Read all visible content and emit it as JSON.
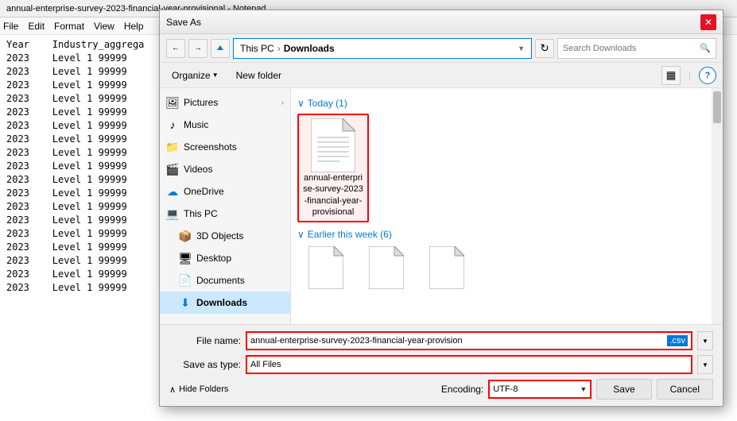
{
  "notepad": {
    "title": "annual-enterprise-survey-2023-financial-year-provisional - Notepad",
    "menu": {
      "file": "File",
      "edit": "Edit",
      "format": "Format",
      "view": "View",
      "help": "Help"
    },
    "rows": [
      {
        "col1": "Year",
        "col2": "Industry_aggrega"
      },
      {
        "col1": "2023",
        "col2": "Level 1 99999"
      },
      {
        "col1": "2023",
        "col2": "Level 1 99999"
      },
      {
        "col1": "2023",
        "col2": "Level 1 99999"
      },
      {
        "col1": "2023",
        "col2": "Level 1 99999"
      },
      {
        "col1": "2023",
        "col2": "Level 1 99999"
      },
      {
        "col1": "2023",
        "col2": "Level 1 99999"
      },
      {
        "col1": "2023",
        "col2": "Level 1 99999"
      },
      {
        "col1": "2023",
        "col2": "Level 1 99999"
      },
      {
        "col1": "2023",
        "col2": "Level 1 99999"
      },
      {
        "col1": "2023",
        "col2": "Level 1 99999"
      },
      {
        "col1": "2023",
        "col2": "Level 1 99999"
      },
      {
        "col1": "2023",
        "col2": "Level 1 99999"
      },
      {
        "col1": "2023",
        "col2": "Level 1 99999"
      },
      {
        "col1": "2023",
        "col2": "Level 1 99999"
      },
      {
        "col1": "2023",
        "col2": "Level 1 99999"
      },
      {
        "col1": "2023",
        "col2": "Level 1 99999"
      },
      {
        "col1": "2023",
        "col2": "Level 1 99999"
      },
      {
        "col1": "2023",
        "col2": "Level 1 99999"
      }
    ]
  },
  "dialog": {
    "title": "Save As",
    "close_label": "✕",
    "nav_back": "←",
    "nav_forward": "→",
    "nav_up": "↑",
    "address": {
      "this_pc": "This PC",
      "arrow": "›",
      "downloads": "Downloads",
      "dropdown_arrow": "▼"
    },
    "search_placeholder": "Search Downloads",
    "refresh_icon": "↻",
    "toolbar": {
      "organize": "Organize",
      "organize_arrow": "▼",
      "new_folder": "New folder",
      "view_icon": "▦",
      "help_label": "?"
    },
    "nav_items": [
      {
        "icon": "🖼",
        "label": "Pictures",
        "has_expand": true
      },
      {
        "icon": "♪",
        "label": "Music",
        "has_expand": false
      },
      {
        "icon": "📁",
        "label": "Screenshots",
        "has_expand": false
      },
      {
        "icon": "🎬",
        "label": "Videos",
        "has_expand": false
      },
      {
        "icon": "☁",
        "label": "OneDrive",
        "has_expand": false
      },
      {
        "icon": "💻",
        "label": "This PC",
        "has_expand": false
      },
      {
        "icon": "📦",
        "label": "3D Objects",
        "has_expand": false
      },
      {
        "icon": "🖥",
        "label": "Desktop",
        "has_expand": false
      },
      {
        "icon": "📄",
        "label": "Documents",
        "has_expand": false
      },
      {
        "icon": "⬇",
        "label": "Downloads",
        "has_expand": false,
        "active": true
      }
    ],
    "today_header": "Today (1)",
    "today_chevron": "∨",
    "file_today": {
      "name": "annual-enterprise-survey-2023-financial-year-provisional",
      "ext": ""
    },
    "earlier_header": "Earlier this week (6)",
    "earlier_chevron": "∨",
    "bottom": {
      "filename_label": "File name:",
      "filename_value": "annual-enterprise-survey-2023-financial-year-provision",
      "filename_ext": ".csv",
      "savetype_label": "Save as type:",
      "savetype_value": "All Files",
      "encoding_label": "Encoding:",
      "encoding_value": "UTF-8",
      "hide_folders": "Hide Folders",
      "hide_folders_arrow": "∧",
      "save_label": "Save",
      "cancel_label": "Cancel"
    }
  }
}
